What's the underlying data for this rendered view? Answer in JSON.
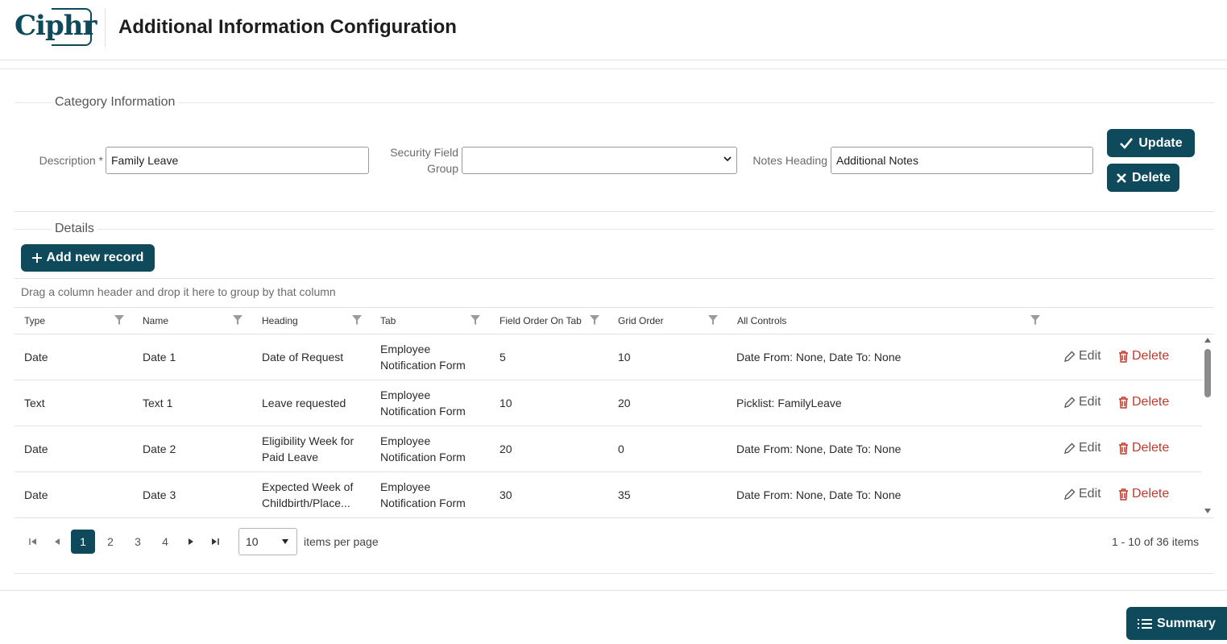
{
  "header": {
    "logo_text": "Ciphr",
    "title": "Additional Information Configuration"
  },
  "category": {
    "legend": "Category Information",
    "description_label": "Description *",
    "description_value": "Family Leave",
    "security_label_line1": "Security Field",
    "security_label_line2": "Group",
    "security_value": "",
    "notes_label": "Notes Heading",
    "notes_value": "Additional Notes",
    "update_label": "Update",
    "delete_label": "Delete"
  },
  "details": {
    "legend": "Details",
    "add_label": "Add new record",
    "group_hint": "Drag a column header and drop it here to group by that column"
  },
  "grid": {
    "columns": [
      "Type",
      "Name",
      "Heading",
      "Tab",
      "Field Order On Tab",
      "Grid Order",
      "All Controls"
    ],
    "edit_label": "Edit",
    "delete_label": "Delete",
    "rows": [
      {
        "type": "Date",
        "name": "Date 1",
        "heading": [
          "Date of Request"
        ],
        "tab": [
          "Employee",
          "Notification Form"
        ],
        "field_order": "5",
        "grid_order": "10",
        "controls": "Date From: None, Date To: None"
      },
      {
        "type": "Text",
        "name": "Text 1",
        "heading": [
          "Leave requested"
        ],
        "tab": [
          "Employee",
          "Notification Form"
        ],
        "field_order": "10",
        "grid_order": "20",
        "controls": "Picklist: FamilyLeave"
      },
      {
        "type": "Date",
        "name": "Date 2",
        "heading": [
          "Eligibility Week for",
          "Paid Leave"
        ],
        "tab": [
          "Employee",
          "Notification Form"
        ],
        "field_order": "20",
        "grid_order": "0",
        "controls": "Date From: None, Date To: None"
      },
      {
        "type": "Date",
        "name": "Date 3",
        "heading": [
          "Expected Week of",
          "Childbirth/Place..."
        ],
        "tab": [
          "Employee",
          "Notification Form"
        ],
        "field_order": "30",
        "grid_order": "35",
        "controls": "Date From: None, Date To: None"
      }
    ]
  },
  "pager": {
    "pages": [
      "1",
      "2",
      "3",
      "4"
    ],
    "current_page": "1",
    "page_size": "10",
    "items_per_page_label": "items per page",
    "summary": "1 - 10 of 36 items"
  },
  "footer": {
    "summary_label": "Summary"
  },
  "colors": {
    "brand": "#0e4a5c",
    "danger": "#c0392b"
  }
}
